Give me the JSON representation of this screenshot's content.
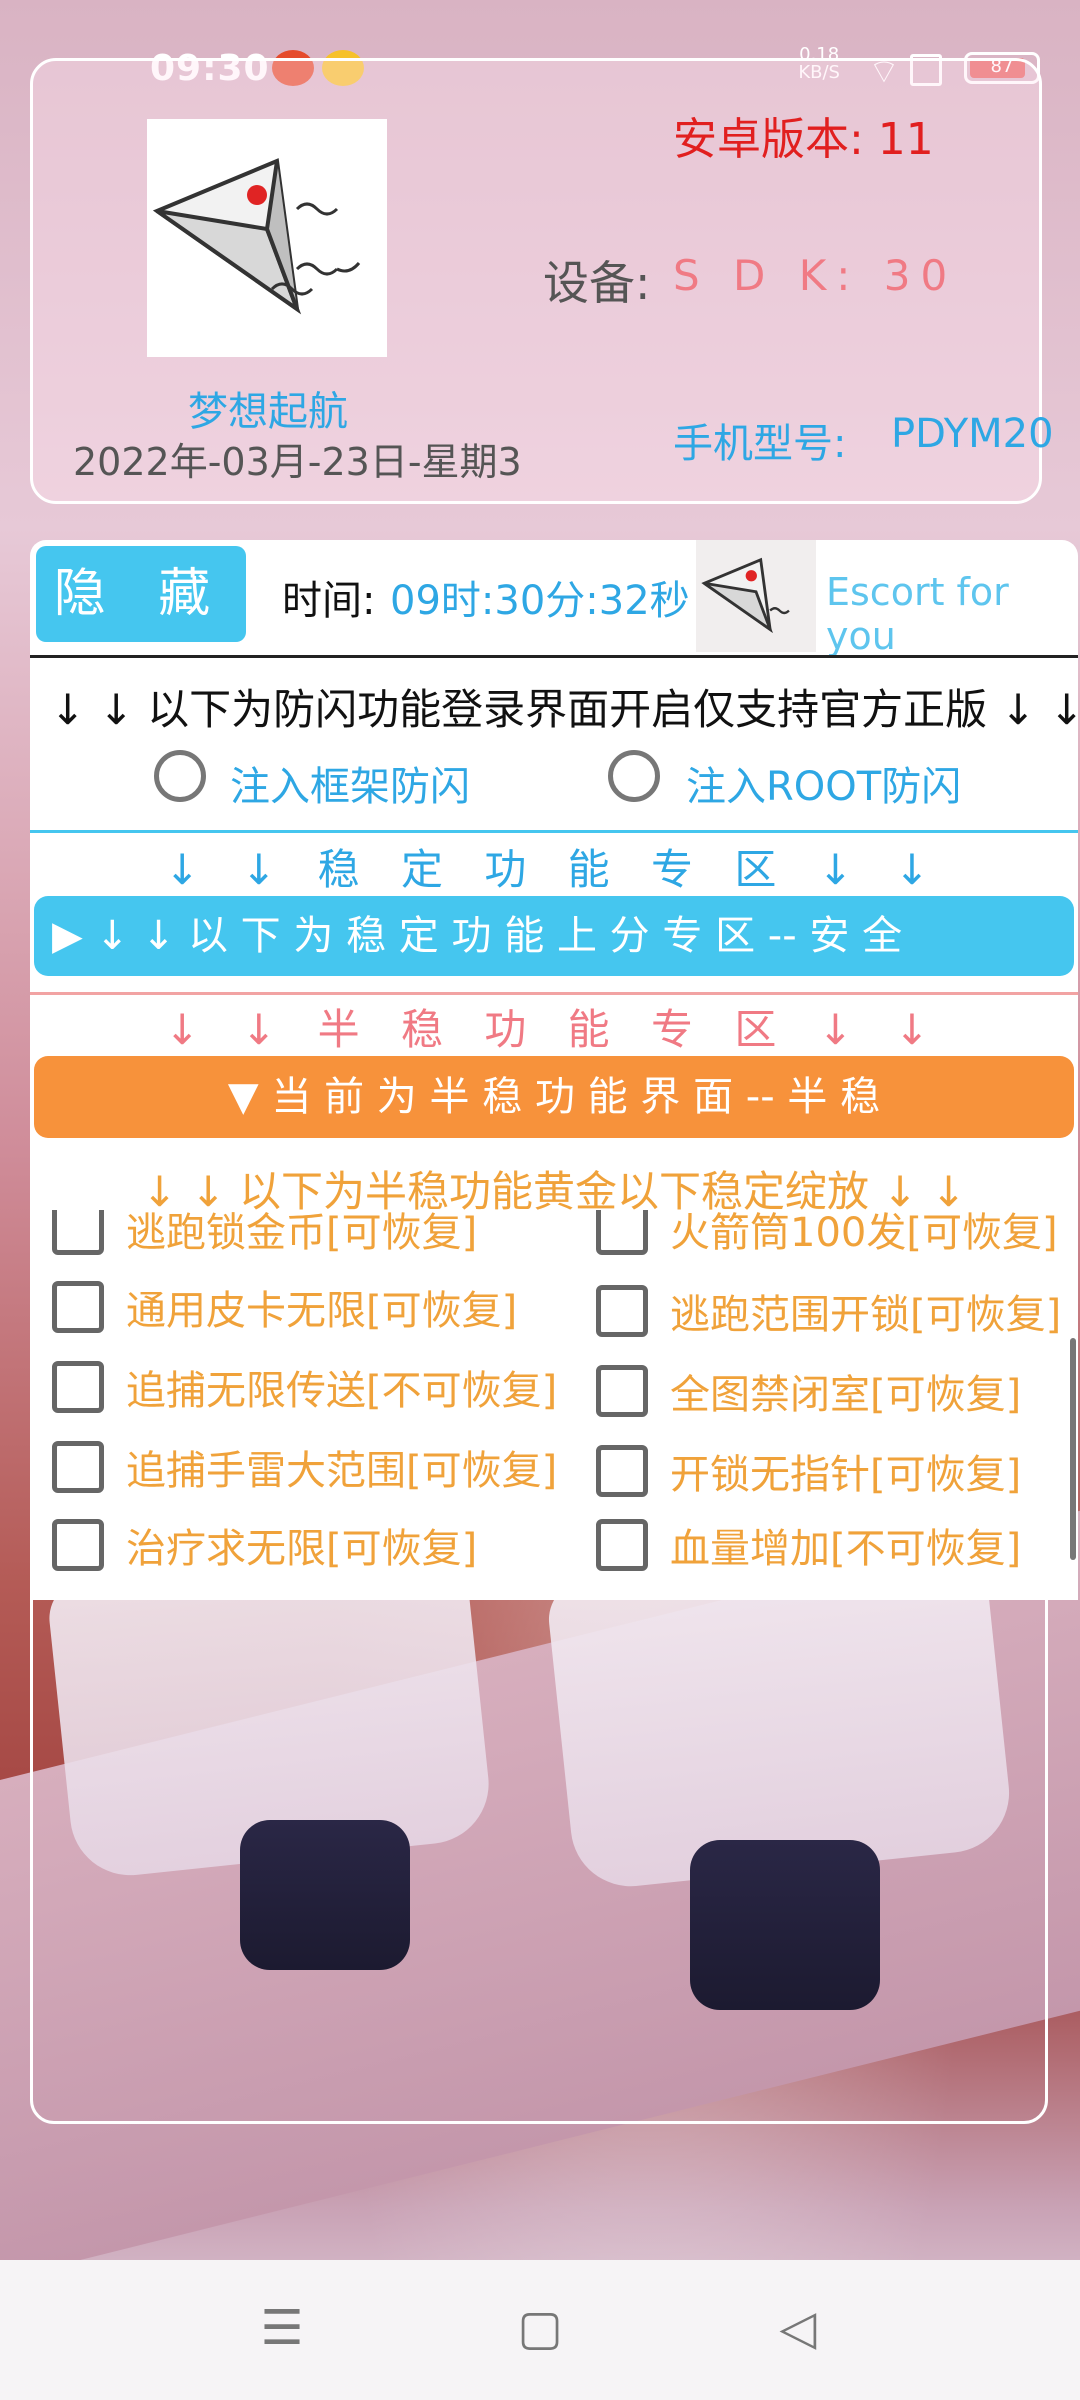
{
  "status_bar": {
    "time": "09:30",
    "net_speed_value": "0.18",
    "net_speed_unit": "KB/S",
    "battery_level": "87",
    "icons": [
      "notification-app-icon",
      "weibo-icon",
      "wifi-icon",
      "sim-icon",
      "battery-icon"
    ]
  },
  "top_card": {
    "app_name": "梦想起航",
    "date": "2022年-03月-23日-星期3",
    "android_version": "安卓版本: 11",
    "device_label": "设备:",
    "device_value": "S D K: 30",
    "model_label": "手机型号:",
    "model_value": "PDYM20"
  },
  "panel": {
    "hide_button": "隐 藏",
    "time_label": "时间:",
    "time_value": "09时:30分:32秒",
    "escort": "Escort for you",
    "warning": "↓ ↓ 以下为防闪功能登录界面开启仅支持官方正版 ↓ ↓",
    "radio_options": [
      "注入框架防闪",
      "注入ROOT防闪"
    ],
    "stable_title": "↓ ↓ 稳 定 功 能 专 区 ↓ ↓",
    "stable_bar": "▶  ↓  ↓  以 下 为 稳 定 功 能 上 分 专 区 -- 安 全",
    "semi_title": "↓ ↓ 半 稳 功 能 专 区 ↓ ↓",
    "semi_bar": "▼  当 前 为 半 稳 功 能 界 面 -- 半 稳",
    "semi_warning": "↓ ↓ 以下为半稳功能黄金以下稳定绽放 ↓ ↓",
    "checkboxes_left": [
      "逃跑锁金币[可恢复]",
      "通用皮卡无限[可恢复]",
      "追捕无限传送[不可恢复]",
      "追捕手雷大范围[可恢复]",
      "治疗求无限[可恢复]"
    ],
    "checkboxes_right": [
      "火箭筒100发[可恢复]",
      "逃跑范围开锁[可恢复]",
      "全图禁闭室[可恢复]",
      "开锁无指针[可恢复]",
      "血量增加[不可恢复]"
    ]
  },
  "nav_bar": {
    "menu": "☰",
    "home": "▢",
    "back": "◁"
  },
  "colors": {
    "accent_blue": "#45c6ef",
    "accent_orange": "#f7923b",
    "text_orange": "#f0a23a",
    "text_red": "#e11f1f"
  }
}
